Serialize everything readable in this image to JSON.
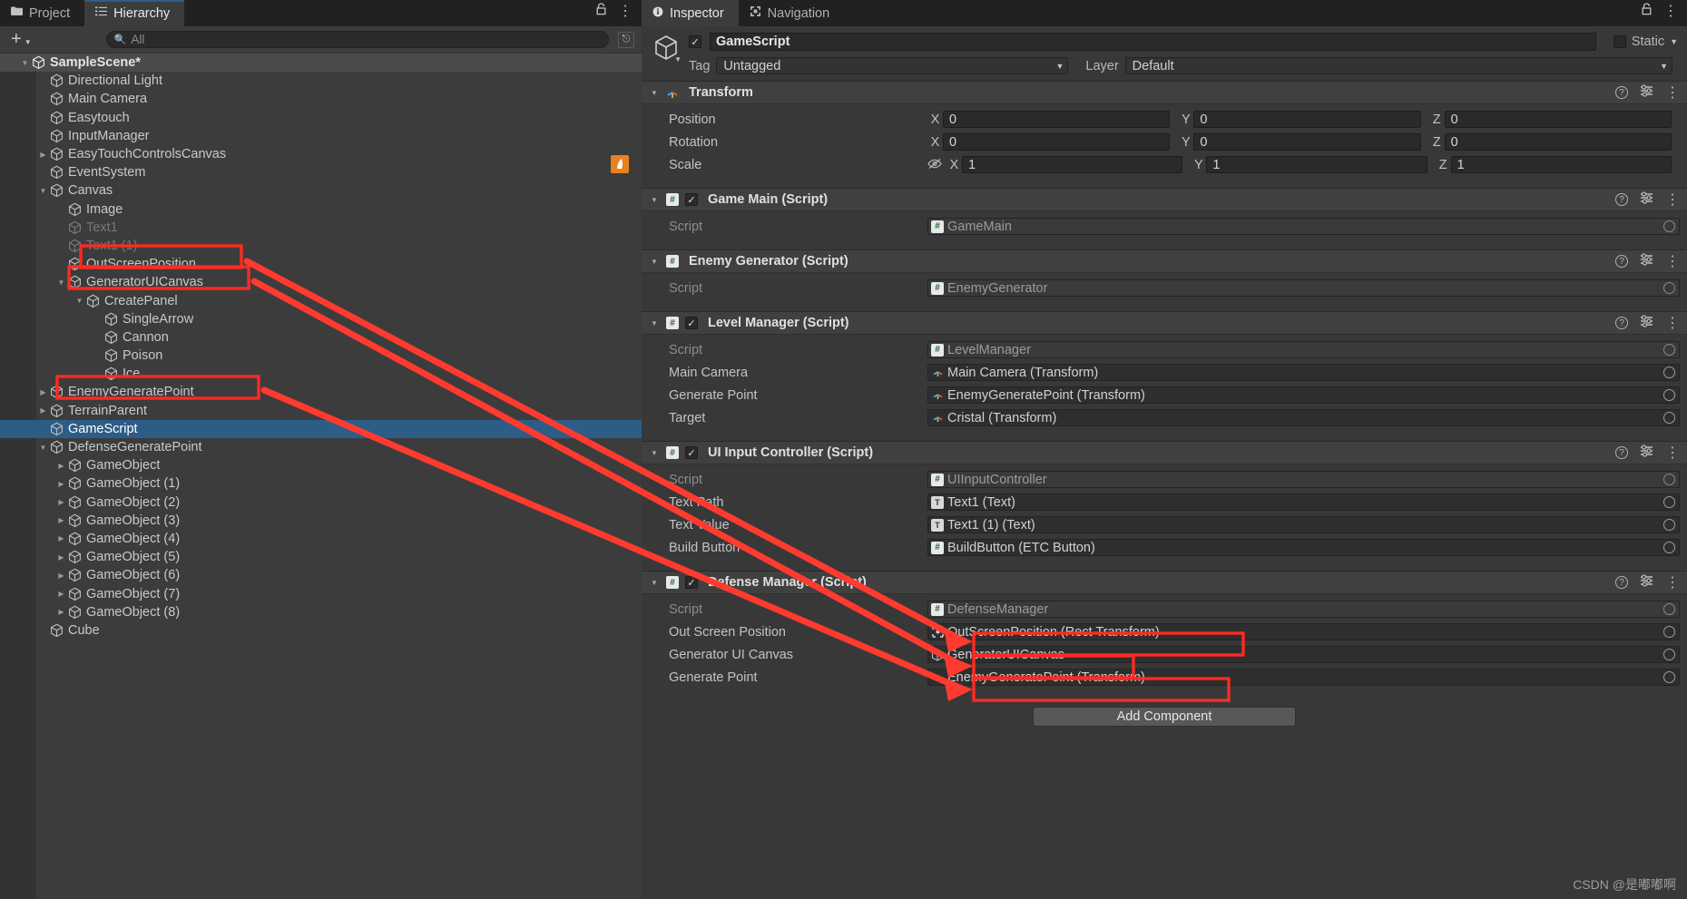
{
  "hierarchy": {
    "tabs": [
      {
        "label": "Project",
        "icon": "folder-icon",
        "active": false
      },
      {
        "label": "Hierarchy",
        "icon": "hierarchy-icon",
        "active": true
      }
    ],
    "toolbar": {
      "add_label": "+",
      "search_placeholder": "All",
      "search_value": ""
    },
    "items": [
      {
        "label": "SampleScene*",
        "depth": 0,
        "arrow": "down",
        "state": "scene"
      },
      {
        "label": "Directional Light",
        "depth": 1,
        "arrow": "none",
        "state": "normal"
      },
      {
        "label": "Main Camera",
        "depth": 1,
        "arrow": "none",
        "state": "normal"
      },
      {
        "label": "Easytouch",
        "depth": 1,
        "arrow": "none",
        "state": "normal"
      },
      {
        "label": "InputManager",
        "depth": 1,
        "arrow": "none",
        "state": "normal"
      },
      {
        "label": "EasyTouchControlsCanvas",
        "depth": 1,
        "arrow": "right",
        "state": "normal"
      },
      {
        "label": "EventSystem",
        "depth": 1,
        "arrow": "none",
        "state": "normal"
      },
      {
        "label": "Canvas",
        "depth": 1,
        "arrow": "down",
        "state": "normal"
      },
      {
        "label": "Image",
        "depth": 2,
        "arrow": "none",
        "state": "normal"
      },
      {
        "label": "Text1",
        "depth": 2,
        "arrow": "none",
        "state": "dim"
      },
      {
        "label": "Text1 (1)",
        "depth": 2,
        "arrow": "none",
        "state": "dim"
      },
      {
        "label": "OutScreenPosition",
        "depth": 2,
        "arrow": "none",
        "state": "normal"
      },
      {
        "label": "GeneratorUICanvas",
        "depth": 2,
        "arrow": "down",
        "state": "normal"
      },
      {
        "label": "CreatePanel",
        "depth": 3,
        "arrow": "down",
        "state": "normal"
      },
      {
        "label": "SingleArrow",
        "depth": 4,
        "arrow": "none",
        "state": "normal"
      },
      {
        "label": "Cannon",
        "depth": 4,
        "arrow": "none",
        "state": "normal"
      },
      {
        "label": "Poison",
        "depth": 4,
        "arrow": "none",
        "state": "normal"
      },
      {
        "label": "Ice",
        "depth": 4,
        "arrow": "none",
        "state": "normal"
      },
      {
        "label": "EnemyGeneratePoint",
        "depth": 1,
        "arrow": "right",
        "state": "normal"
      },
      {
        "label": "TerrainParent",
        "depth": 1,
        "arrow": "right",
        "state": "normal"
      },
      {
        "label": "GameScript",
        "depth": 1,
        "arrow": "none",
        "state": "selected"
      },
      {
        "label": "DefenseGeneratePoint",
        "depth": 1,
        "arrow": "down",
        "state": "normal"
      },
      {
        "label": "GameObject",
        "depth": 2,
        "arrow": "right",
        "state": "normal"
      },
      {
        "label": "GameObject (1)",
        "depth": 2,
        "arrow": "right",
        "state": "normal"
      },
      {
        "label": "GameObject (2)",
        "depth": 2,
        "arrow": "right",
        "state": "normal"
      },
      {
        "label": "GameObject (3)",
        "depth": 2,
        "arrow": "right",
        "state": "normal"
      },
      {
        "label": "GameObject (4)",
        "depth": 2,
        "arrow": "right",
        "state": "normal"
      },
      {
        "label": "GameObject (5)",
        "depth": 2,
        "arrow": "right",
        "state": "normal"
      },
      {
        "label": "GameObject (6)",
        "depth": 2,
        "arrow": "right",
        "state": "normal"
      },
      {
        "label": "GameObject (7)",
        "depth": 2,
        "arrow": "right",
        "state": "normal"
      },
      {
        "label": "GameObject (8)",
        "depth": 2,
        "arrow": "right",
        "state": "normal"
      },
      {
        "label": "Cube",
        "depth": 1,
        "arrow": "none",
        "state": "normal"
      }
    ]
  },
  "inspector": {
    "tabs": [
      {
        "label": "Inspector",
        "icon": "info-icon",
        "active": true
      },
      {
        "label": "Navigation",
        "icon": "navigation-icon",
        "active": false
      }
    ],
    "object": {
      "name": "GameScript",
      "enabled_check": "✓",
      "static_label": "Static",
      "tag_label": "Tag",
      "tag_value": "Untagged",
      "layer_label": "Layer",
      "layer_value": "Default"
    },
    "components": [
      {
        "title": "Transform",
        "icon": "transform-icon",
        "has_checkbox": false,
        "rows": [
          {
            "kind": "vector3",
            "name": "Position",
            "axes": [
              "X",
              "Y",
              "Z"
            ],
            "values": [
              "0",
              "0",
              "0"
            ]
          },
          {
            "kind": "vector3",
            "name": "Rotation",
            "axes": [
              "X",
              "Y",
              "Z"
            ],
            "values": [
              "0",
              "0",
              "0"
            ]
          },
          {
            "kind": "vector3",
            "name": "Scale",
            "axes": [
              "X",
              "Y",
              "Z"
            ],
            "values": [
              "1",
              "1",
              "1"
            ],
            "prefix_icon": "eye-off-icon"
          }
        ]
      },
      {
        "title": "Game Main (Script)",
        "icon": "cs-script-icon",
        "has_checkbox": true,
        "rows": [
          {
            "kind": "object",
            "name": "Script",
            "value": "GameMain",
            "badge": "cs",
            "readonly": true
          }
        ]
      },
      {
        "title": "Enemy Generator (Script)",
        "icon": "cs-script-icon",
        "has_checkbox": false,
        "rows": [
          {
            "kind": "object",
            "name": "Script",
            "value": "EnemyGenerator",
            "badge": "cs",
            "readonly": true
          }
        ]
      },
      {
        "title": "Level Manager (Script)",
        "icon": "cs-script-icon",
        "has_checkbox": true,
        "rows": [
          {
            "kind": "object",
            "name": "Script",
            "value": "LevelManager",
            "badge": "cs",
            "readonly": true
          },
          {
            "kind": "object",
            "name": "Main Camera",
            "value": "Main Camera (Transform)",
            "badge": "transform",
            "readonly": false
          },
          {
            "kind": "object",
            "name": "Generate Point",
            "value": "EnemyGeneratePoint (Transform)",
            "badge": "transform",
            "readonly": false
          },
          {
            "kind": "object",
            "name": "Target",
            "value": "Cristal (Transform)",
            "badge": "transform",
            "readonly": false
          }
        ]
      },
      {
        "title": "UI Input Controller (Script)",
        "icon": "cs-script-icon",
        "has_checkbox": true,
        "rows": [
          {
            "kind": "object",
            "name": "Script",
            "value": "UIInputController",
            "badge": "cs",
            "readonly": true
          },
          {
            "kind": "object",
            "name": "Text Path",
            "value": "Text1 (Text)",
            "badge": "text",
            "readonly": false
          },
          {
            "kind": "object",
            "name": "Text Value",
            "value": "Text1 (1) (Text)",
            "badge": "text",
            "readonly": false
          },
          {
            "kind": "object",
            "name": "Build Button",
            "value": "BuildButton (ETC Button)",
            "badge": "cs",
            "readonly": false
          }
        ]
      },
      {
        "title": "Defense Manager (Script)",
        "icon": "cs-script-icon",
        "has_checkbox": true,
        "rows": [
          {
            "kind": "object",
            "name": "Script",
            "value": "DefenseManager",
            "badge": "cs",
            "readonly": true
          },
          {
            "kind": "object",
            "name": "Out Screen Position",
            "value": "OutScreenPosition (Rect Transform)",
            "badge": "rect",
            "readonly": false,
            "highlight": true
          },
          {
            "kind": "object",
            "name": "Generator UI Canvas",
            "value": "GeneratorUICanvas",
            "badge": "gameobject",
            "readonly": false,
            "highlight": true
          },
          {
            "kind": "object",
            "name": "Generate Point",
            "value": "EnemyGeneratePoint (Transform)",
            "badge": "transform",
            "readonly": false,
            "highlight": true
          }
        ]
      }
    ],
    "add_component_label": "Add Component"
  },
  "watermark": "CSDN @是嘟嘟啊",
  "colors": {
    "accent_selection": "#2c5d87",
    "annotation_red": "#ff2a22",
    "panel_bg": "#383838",
    "hierarchy_bg": "#3c3c3c",
    "component_header": "#404040"
  }
}
